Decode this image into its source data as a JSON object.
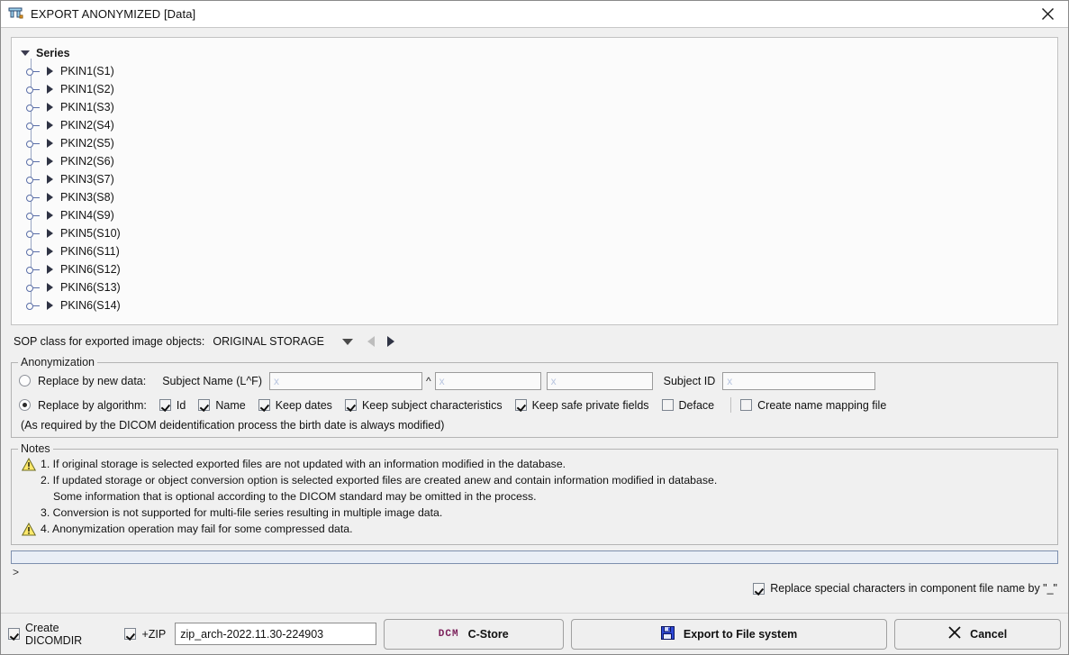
{
  "window": {
    "title": "EXPORT ANONYMIZED [Data]",
    "title_icon": "dicom-app-icon",
    "close_icon": "close-icon"
  },
  "tree": {
    "root_label": "Series",
    "root_expander_icon": "chevron-down-icon",
    "items": [
      {
        "label": "PKIN1(S1)"
      },
      {
        "label": "PKIN1(S2)"
      },
      {
        "label": "PKIN1(S3)"
      },
      {
        "label": "PKIN2(S4)"
      },
      {
        "label": "PKIN2(S5)"
      },
      {
        "label": "PKIN2(S6)"
      },
      {
        "label": "PKIN3(S7)"
      },
      {
        "label": "PKIN3(S8)"
      },
      {
        "label": "PKIN4(S9)"
      },
      {
        "label": "PKIN5(S10)"
      },
      {
        "label": "PKIN6(S11)"
      },
      {
        "label": "PKIN6(S12)"
      },
      {
        "label": "PKIN6(S13)"
      },
      {
        "label": "PKIN6(S14)"
      }
    ]
  },
  "sop": {
    "label": "SOP class for exported image objects:",
    "value": "ORIGINAL STORAGE",
    "dropdown_icon": "triangle-down-icon",
    "prev_icon": "triangle-left-icon",
    "next_icon": "triangle-right-icon"
  },
  "anonymization": {
    "legend": "Anonymization",
    "new_data": {
      "label": "Replace by new data:",
      "selected": false,
      "subject_name_label": "Subject Name (L^F)",
      "last_name_value": "",
      "last_name_placeholder": "x",
      "separator": "^",
      "first_name_value": "",
      "first_name_placeholder": "x",
      "middle_name_value": "",
      "middle_name_placeholder": "x",
      "subject_id_label": "Subject ID",
      "subject_id_value": "",
      "subject_id_placeholder": "x"
    },
    "algorithm": {
      "label": "Replace by algorithm:",
      "selected": true,
      "options": [
        {
          "label": "Id",
          "checked": true
        },
        {
          "label": "Name",
          "checked": true
        },
        {
          "label": "Keep dates",
          "checked": true
        },
        {
          "label": "Keep subject characteristics",
          "checked": true
        },
        {
          "label": "Keep safe private fields",
          "checked": true
        },
        {
          "label": "Deface",
          "checked": false
        }
      ],
      "mapping_option": {
        "label": "Create name mapping file",
        "checked": false
      }
    },
    "footnote": "(As required by the DICOM deidentification process the birth date is always modified)"
  },
  "notes": {
    "legend": "Notes",
    "lines": [
      {
        "warn": true,
        "text": "1. If original storage is selected exported files are not updated with an information modified in the database.",
        "indent": false
      },
      {
        "warn": false,
        "text": "2. If updated storage or object conversion option is selected exported files are created anew and contain information modified in database.",
        "indent": false
      },
      {
        "warn": false,
        "text": "Some information that is optional according to the DICOM standard may be omitted in the process.",
        "indent": true
      },
      {
        "warn": false,
        "text": "3. Conversion is not supported for multi-file series resulting in multiple image data.",
        "indent": false
      },
      {
        "warn": true,
        "text": "4. Anonymization operation may fail for some compressed data.",
        "indent": false
      }
    ],
    "warn_icon": "warning-triangle-icon"
  },
  "progress": {
    "value": 0,
    "status_text": ">"
  },
  "special_chars": {
    "label": "Replace special characters in component file name by \"_\"",
    "checked": true
  },
  "bottom": {
    "create_dicomdir": {
      "label": "Create DICOMDIR",
      "checked": true
    },
    "zip": {
      "label": "+ZIP",
      "checked": true
    },
    "archive_name_value": "zip_arch-2022.11.30-224903",
    "archive_name_placeholder": "",
    "cstore_button": {
      "label": "C-Store",
      "glyph": "DCM",
      "icon": "dcm-icon"
    },
    "export_button": {
      "label": "Export to File system",
      "icon": "floppy-disk-icon"
    },
    "cancel_button": {
      "label": "Cancel",
      "icon": "close-x-icon"
    }
  },
  "colors": {
    "window_bg": "#f0f0f0",
    "panel_bg": "#fbfbfb",
    "tree_line": "#9aa7c4",
    "progress_border": "#7d8fae",
    "dcm_text": "#7a1f5a",
    "floppy": "#2a3fcd",
    "warn_fill": "#ffe96b"
  }
}
